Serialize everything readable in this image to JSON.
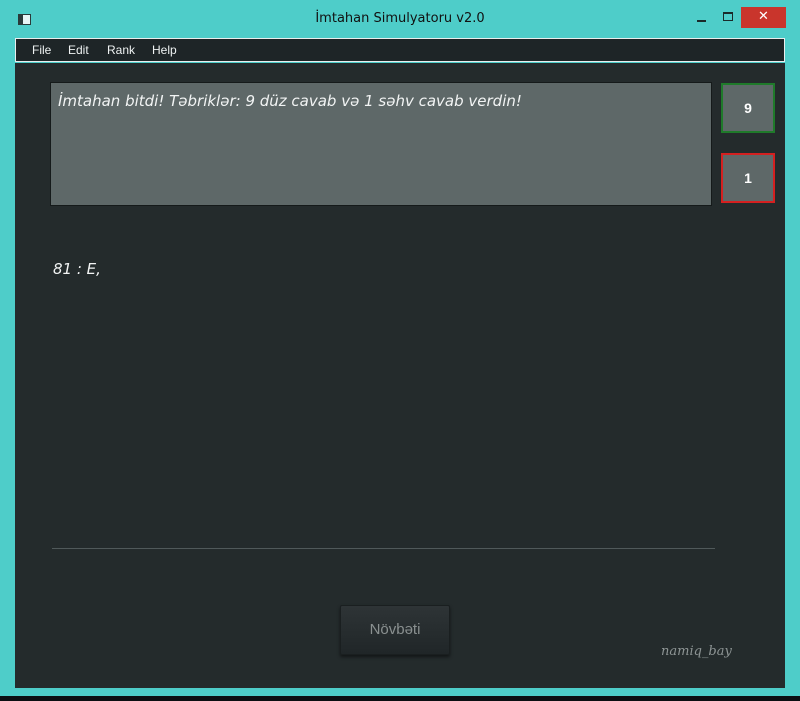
{
  "window": {
    "title": "İmtahan Simulyatoru v2.0",
    "close_glyph": "✕"
  },
  "menu": {
    "items": [
      "File",
      "Edit",
      "Rank",
      "Help"
    ]
  },
  "main": {
    "message": "İmtahan bitdi! Təbriklər: 9 düz cavab və 1 səhv cavab verdin!",
    "correct_count": "9",
    "wrong_count": "1",
    "answer_text": "81 : E,",
    "next_button_label": "Növbəti",
    "signature": "namiq_bay"
  },
  "colors": {
    "window_frame": "#4ecdc9",
    "content_bg": "#242b2c",
    "message_bg": "#5e6868",
    "correct_border": "#1f7a2a",
    "wrong_border": "#d42020",
    "close_button": "#c9352c"
  },
  "icons": {
    "app": "app-window-icon",
    "minimize": "minimize-icon",
    "maximize": "maximize-icon",
    "close": "close-icon"
  }
}
